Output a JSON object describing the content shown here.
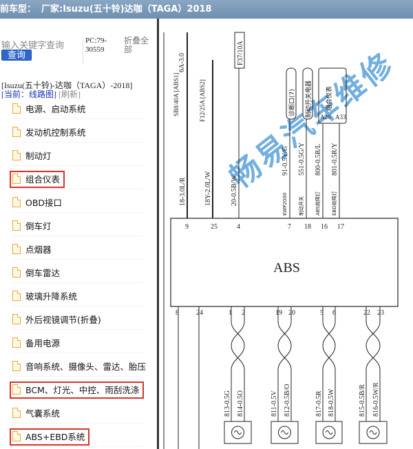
{
  "title": {
    "prefix": "前车型：",
    "text": "厂家:Isuzu(五十铃)达咖（TAGA）2018"
  },
  "sidebar": {
    "search_placeholder": "输入关键字查询",
    "query_label": "查询",
    "pc_code": "PC:79-30559",
    "fold_all": "折叠全部",
    "model_line": "[Isuzu(五十铃)-达咖（TAGA）-2018]",
    "current_label": "[当前：线路图]",
    "refresh_label": "[刷新]",
    "items": [
      {
        "label": "电源、启动系统",
        "highlighted": false
      },
      {
        "label": "发动机控制系统",
        "highlighted": false
      },
      {
        "label": "制动灯",
        "highlighted": false
      },
      {
        "label": "组合仪表",
        "highlighted": true
      },
      {
        "label": "OBD接口",
        "highlighted": false
      },
      {
        "label": "倒车灯",
        "highlighted": false
      },
      {
        "label": "点烟器",
        "highlighted": false
      },
      {
        "label": "倒车雷达",
        "highlighted": false
      },
      {
        "label": "玻璃升降系统",
        "highlighted": false
      },
      {
        "label": "外后视镜调节(折叠)",
        "highlighted": false
      },
      {
        "label": "备用电源",
        "highlighted": false
      },
      {
        "label": "音响系统、摄像头、雷达、胎压",
        "highlighted": false
      },
      {
        "label": "BCM、灯光、中控、雨刮洗涤",
        "highlighted": true
      },
      {
        "label": "气囊系统",
        "highlighted": false
      },
      {
        "label": "ABS+EBD系统",
        "highlighted": true
      }
    ],
    "highlight_color": "#d9332b"
  },
  "diagram": {
    "module_label": "ABS",
    "watermark": "畅易汽车维修",
    "top_labels": {
      "fuse1": "SB8/40A [ABS1]",
      "fuse1_top": "6A-3.0",
      "fuse2": "F12/25A [ABS2]",
      "fuse3": "F37/10A",
      "diag": "诊断口(7)",
      "brake_sw": "制动开关电器",
      "cluster": "组合仪表",
      "pin_a26": "A26",
      "pin_a33": "A33"
    },
    "wires_top": [
      {
        "wire": "18-3.0L/R",
        "pin": "9"
      },
      {
        "wire": "18Y-2.0L/W",
        "pin": "25"
      },
      {
        "wire": "20-0.5B/W",
        "pin": "4"
      },
      {
        "wire": "91-0.5Y/G",
        "pin": "7",
        "sub": "KWP2000"
      },
      {
        "wire": "551-0.5G/Y",
        "pin": "18",
        "sub": "制动开关"
      },
      {
        "wire": "800-0.5R/L",
        "pin": "16",
        "sub": "ABS故障灯"
      },
      {
        "wire": "801-0.5R/Y",
        "pin": "17",
        "sub": "EBD故障灯"
      }
    ],
    "pins_bottom": [
      "8",
      "24",
      "1",
      "2",
      "19",
      "20",
      "5",
      "6",
      "22",
      "23"
    ],
    "wires_bottom": [
      "813-0.5G",
      "814-0.5O",
      "811-0.5V",
      "812-0.5B/O",
      "817-0.5R",
      "818-0.5W",
      "815-0.5B/R",
      "816-0.5W/R"
    ],
    "colors": {
      "watermark": "#4f9ad8",
      "line": "#222222"
    }
  }
}
